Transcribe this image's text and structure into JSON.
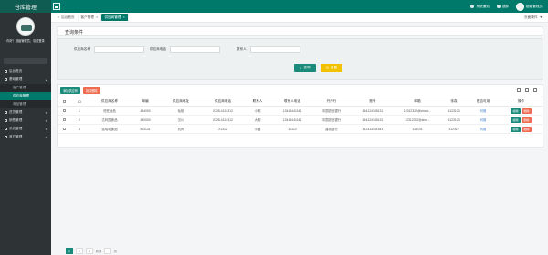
{
  "header": {
    "app_title": "仓库管理",
    "notifications_label": "系统通知",
    "lock_label": "锁屏",
    "user_name": "超级管理员"
  },
  "sidebar": {
    "profile_text": "你好！超级管理员，欢迎登录",
    "items": [
      {
        "label": "后台首页",
        "icon": "home-icon"
      },
      {
        "label": "基础管理",
        "icon": "gear-icon",
        "expanded": true
      },
      {
        "label": "客户管理",
        "sub": true
      },
      {
        "label": "供应商管理",
        "sub": true,
        "active": true
      },
      {
        "label": "商品管理",
        "sub": true
      },
      {
        "label": "进货管理",
        "icon": "cart-icon"
      },
      {
        "label": "销售管理",
        "icon": "chart-icon"
      },
      {
        "label": "系统管理",
        "icon": "settings-icon"
      },
      {
        "label": "其它管理",
        "icon": "more-icon"
      }
    ]
  },
  "tabs": [
    {
      "label": "后台首页"
    },
    {
      "label": "客户管理"
    },
    {
      "label": "供应商管理",
      "active": true
    }
  ],
  "tabs_right_label": "页面操作",
  "query": {
    "title": "查询条件",
    "fields": [
      {
        "label": "供应商名称",
        "placeholder": ""
      },
      {
        "label": "供应商电话",
        "placeholder": ""
      },
      {
        "label": "联系人",
        "placeholder": ""
      }
    ],
    "search_label": "查询",
    "reset_label": "重置"
  },
  "table": {
    "add_label": "添加供应商",
    "delete_label": "批量删除",
    "columns": [
      "",
      "ID",
      "供应商名称",
      "邮编",
      "供应商地址",
      "供应商电话",
      "联系人",
      "联系人电话",
      "开户行",
      "账号",
      "邮箱",
      "传真",
      "是否可用",
      "操作"
    ],
    "rows": [
      {
        "id": "1",
        "name": "旺旺食品",
        "zip": "434000",
        "address": "仙桃",
        "phone": "0728-4124312",
        "contact": "小明",
        "contact_phone": "13413441141",
        "bank": "中国农业银行",
        "account": "654124345131",
        "email": "12312322@sina.c...",
        "fax": "5123123",
        "status": "可用"
      },
      {
        "id": "2",
        "name": "达利园食品",
        "zip": "430000",
        "address": "汉川",
        "phone": "0728-4124312",
        "contact": "大明",
        "contact_phone": "13413441141",
        "bank": "中国农业银行",
        "account": "654124345131",
        "email": "12312322@sina...",
        "fax": "5123123",
        "status": "可用"
      },
      {
        "id": "3",
        "name": "娃哈哈集团",
        "zip": "513131",
        "address": "杭州",
        "phone": "21312",
        "contact": "小晨",
        "contact_phone": "12312",
        "bank": "建设银行",
        "account": "512314141541",
        "email": "123131",
        "fax": "312312",
        "status": "可用"
      }
    ],
    "edit_label": "编辑",
    "row_delete_label": "删除"
  },
  "pager": {
    "pages": [
      "1",
      "2",
      "3"
    ],
    "goto_label": "到第",
    "page_suffix": "页"
  }
}
